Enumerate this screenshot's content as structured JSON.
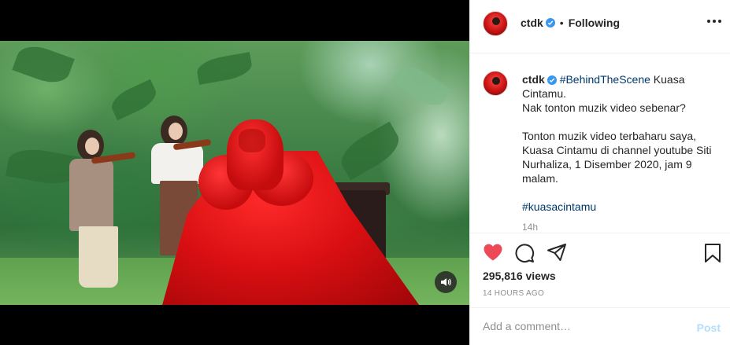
{
  "post": {
    "username": "ctdk",
    "follow_status": "Following",
    "separator": "•",
    "caption": {
      "hashtag_intro": "#BehindTheScene",
      "line1_rest": " Kuasa",
      "line2": "Cintamu.",
      "line3": "Nak tonton muzik video sebenar?",
      "line4": "Tonton muzik video terbaharu saya,",
      "line5": "Kuasa Cintamu di channel youtube Siti",
      "line6": "Nurhaliza, 1 Disember 2020, jam 9",
      "line7": "malam.",
      "hashtag_end": "#kuasacintamu",
      "age": "14h"
    },
    "views": "295,816 views",
    "posted": "14 HOURS AGO"
  },
  "comment_box": {
    "placeholder": "Add a comment…",
    "post_label": "Post"
  },
  "icons": {
    "verified": "verified-badge-icon",
    "like": "heart-icon",
    "comment": "comment-bubble-icon",
    "share": "paper-plane-icon",
    "save": "bookmark-icon",
    "more": "ellipsis-icon",
    "sound": "speaker-icon"
  },
  "colors": {
    "like_active": "#ed4956",
    "verified_blue": "#3897f0",
    "hashtag": "#00376b",
    "post_disabled": "#b2dffc"
  }
}
